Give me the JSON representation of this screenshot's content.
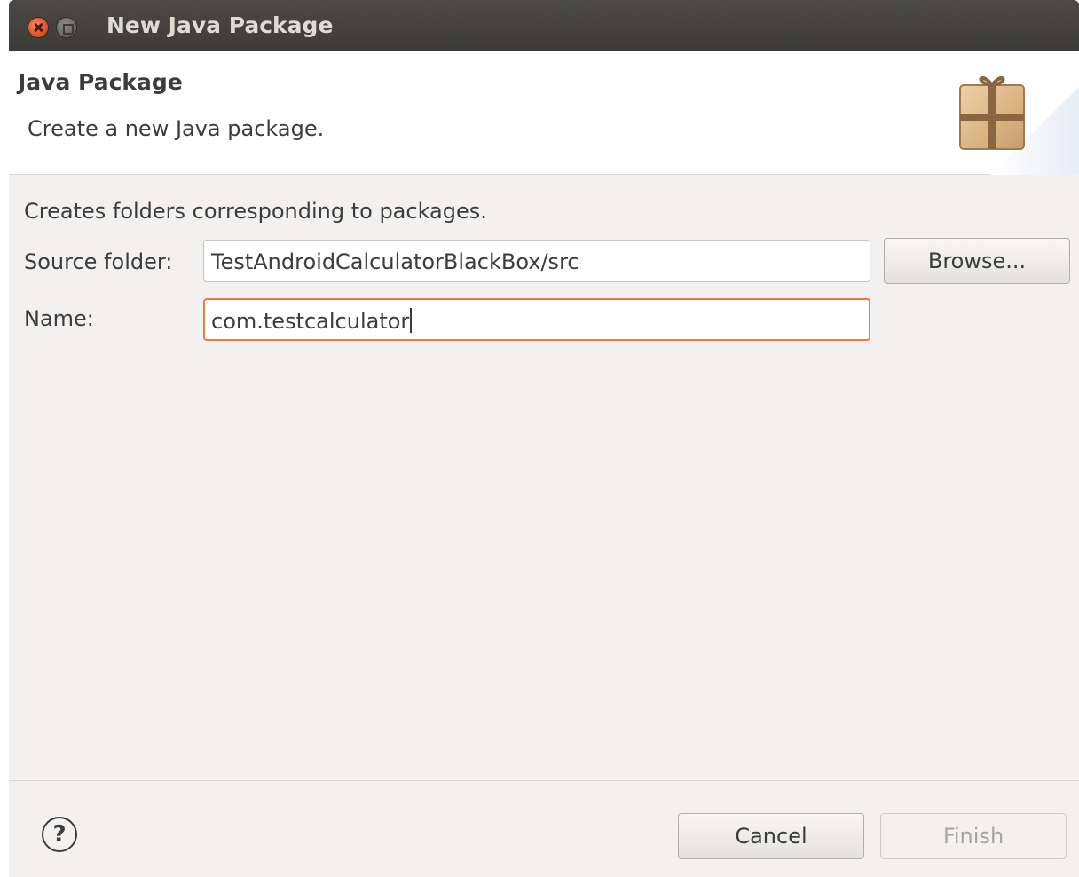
{
  "window": {
    "title": "New Java Package"
  },
  "banner": {
    "title": "Java Package",
    "description": "Create a new Java package.",
    "icon": "package-icon"
  },
  "form": {
    "intro": "Creates folders corresponding to packages.",
    "source_folder_label": "Source folder:",
    "source_folder_value": "TestAndroidCalculatorBlackBox/src",
    "name_label": "Name:",
    "name_value": "com.testcalculator",
    "browse_label": "Browse..."
  },
  "footer": {
    "help_glyph": "?",
    "cancel_label": "Cancel",
    "finish_label": "Finish"
  },
  "colors": {
    "titlebar": "#3c3b37",
    "close_button": "#e0532a",
    "focus_border": "#f07746",
    "background": "#f2f1f0"
  }
}
